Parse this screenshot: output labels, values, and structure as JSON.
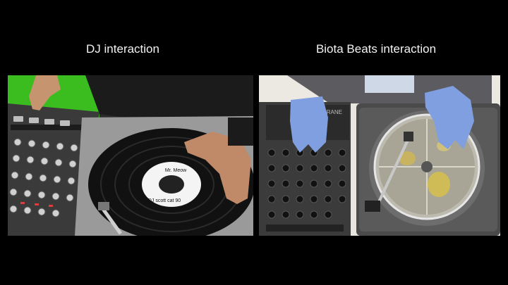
{
  "captions": {
    "left": "DJ interaction",
    "right": "Biota Beats interaction"
  },
  "record_label": {
    "line1": "Mr. Meow",
    "line2": "DJ scott cat 90"
  },
  "mixer_brand": "RANE",
  "colors": {
    "background": "#000000",
    "caption": "#f2f2f2",
    "green_screen": "#3bbd1f",
    "glove": "#7f9fe0"
  }
}
